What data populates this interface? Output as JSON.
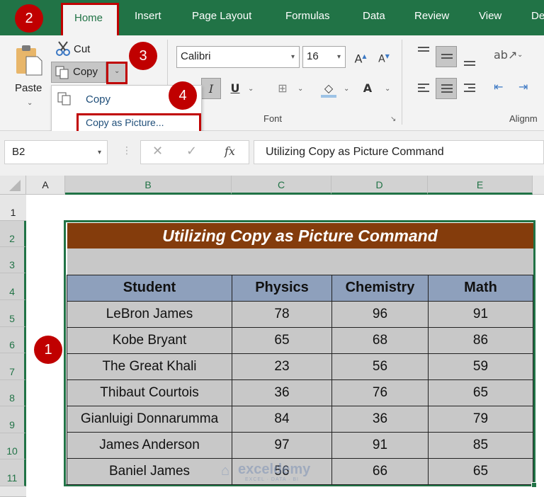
{
  "ribbon_tabs": [
    "Home",
    "Insert",
    "Page Layout",
    "Formulas",
    "Data",
    "Review",
    "View",
    "De"
  ],
  "clipboard": {
    "paste_label": "Paste",
    "cut_label": "Cut",
    "copy_label": "Copy",
    "menu": {
      "items": [
        "Copy",
        "Copy as Picture..."
      ]
    }
  },
  "font": {
    "name": "Calibri",
    "size": "16",
    "group_label": "Font"
  },
  "alignment": {
    "group_label": "Alignm"
  },
  "badges": [
    "1",
    "2",
    "3",
    "4"
  ],
  "formula_bar": {
    "name_box": "B2",
    "fx": "fx",
    "formula": "Utilizing Copy as Picture Command"
  },
  "grid": {
    "columns": [
      "A",
      "B",
      "C",
      "D",
      "E"
    ],
    "rows": [
      "1",
      "2",
      "3",
      "4",
      "5",
      "6",
      "7",
      "8",
      "9",
      "10",
      "11"
    ]
  },
  "table": {
    "title": "Utilizing Copy as Picture Command",
    "headers": [
      "Student",
      "Physics",
      "Chemistry",
      "Math"
    ],
    "rows": [
      [
        "LeBron James",
        "78",
        "96",
        "91"
      ],
      [
        "Kobe Bryant",
        "65",
        "68",
        "86"
      ],
      [
        "The Great Khali",
        "23",
        "56",
        "59"
      ],
      [
        "Thibaut Courtois",
        "36",
        "76",
        "65"
      ],
      [
        "Gianluigi Donnarumma",
        "84",
        "36",
        "79"
      ],
      [
        "James Anderson",
        "97",
        "91",
        "85"
      ],
      [
        "Baniel James",
        "56",
        "66",
        "65"
      ]
    ]
  },
  "watermark": {
    "brand": "exceldemy",
    "tagline": "EXCEL · DATA · BI"
  },
  "colors": {
    "excel_green": "#217346",
    "title_fill": "#843c0c",
    "header_fill": "#8ea0bc",
    "badge_red": "#c00000"
  }
}
